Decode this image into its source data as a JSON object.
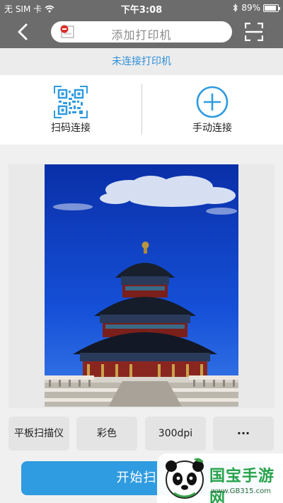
{
  "status_bar": {
    "carrier": "无 SIM 卡",
    "time": "下午3:08",
    "battery": "89%",
    "battery_level": 0.89
  },
  "nav": {
    "title": "添加打印机",
    "back_icon": "chevron-left-icon",
    "scan_icon": "scan-frame-icon"
  },
  "connection_status": "未连接打印机",
  "connect_options": {
    "qr": {
      "label": "扫码连接",
      "icon": "qr-code-icon"
    },
    "manual": {
      "label": "手动连接",
      "icon": "plus-circle-icon"
    }
  },
  "options": {
    "device": "平板扫描仪",
    "color": "彩色",
    "resolution": "300dpi",
    "more": "···"
  },
  "start_button": "开始扫描",
  "watermark": {
    "text": "国宝手游网",
    "url": "www.GB315.com"
  },
  "colors": {
    "accent": "#2f9be0",
    "status_text": "#2f8fd8",
    "nav_bg": "#6c6c6c"
  }
}
